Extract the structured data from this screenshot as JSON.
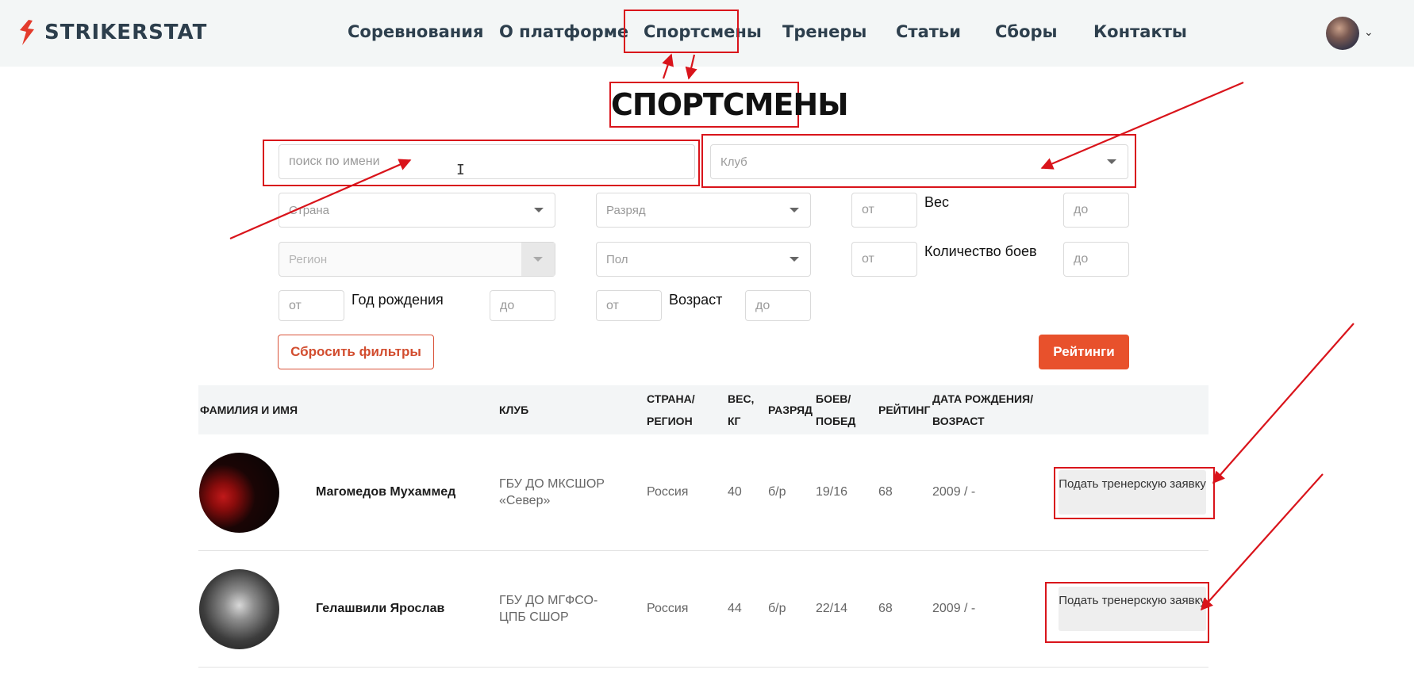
{
  "header": {
    "logo_text": "STRIKERSTAT",
    "nav": [
      {
        "label": "Соревнования"
      },
      {
        "label": "О платформе"
      },
      {
        "label": "Спортсмены"
      },
      {
        "label": "Тренеры"
      },
      {
        "label": "Статьи"
      },
      {
        "label": "Сборы"
      },
      {
        "label": "Контакты"
      }
    ]
  },
  "page": {
    "title": "СПОРТСМЕНЫ"
  },
  "filters": {
    "search_placeholder": "поиск по имени",
    "club_placeholder": "Клуб",
    "country_placeholder": "Страна",
    "rank_placeholder": "Разряд",
    "region_placeholder": "Регион",
    "sex_placeholder": "Пол",
    "from_placeholder": "от",
    "to_placeholder": "до",
    "weight_label": "Вес",
    "fights_label": "Количество боев",
    "birth_year_label": "Год рождения",
    "age_label": "Возраст",
    "reset_label": "Сбросить фильтры",
    "ratings_label": "Рейтинги"
  },
  "table": {
    "headers": {
      "name": "ФАМИЛИЯ И ИМЯ",
      "club": "КЛУБ",
      "country_1": "СТРАНА/",
      "country_2": "РЕГИОН",
      "weight_1": "ВЕС,",
      "weight_2": "КГ",
      "rank": "РАЗРЯД",
      "fights_1": "БОЕВ/",
      "fights_2": "ПОБЕД",
      "rating": "РЕЙТИНГ",
      "birth_1": "ДАТА РОЖДЕНИЯ/",
      "birth_2": "ВОЗРАСТ"
    },
    "rows": [
      {
        "name": "Магомедов Мухаммед",
        "club": "ГБУ ДО МКСШОР «Север»",
        "country": "Россия",
        "weight": "40",
        "rank": "б/р",
        "fights": "19/16",
        "rating": "68",
        "birth": "2009 / -",
        "action": "Подать тренерскую заявку"
      },
      {
        "name": "Гелашвили Ярослав",
        "club": "ГБУ ДО МГФСО- ЦПБ СШОР",
        "country": "Россия",
        "weight": "44",
        "rank": "б/р",
        "fights": "22/14",
        "rating": "68",
        "birth": "2009 / -",
        "action": "Подать тренерскую заявку"
      }
    ]
  },
  "colors": {
    "accent": "#e8512c",
    "annotation": "#d9141b",
    "nav_text": "#2d3f4d"
  }
}
